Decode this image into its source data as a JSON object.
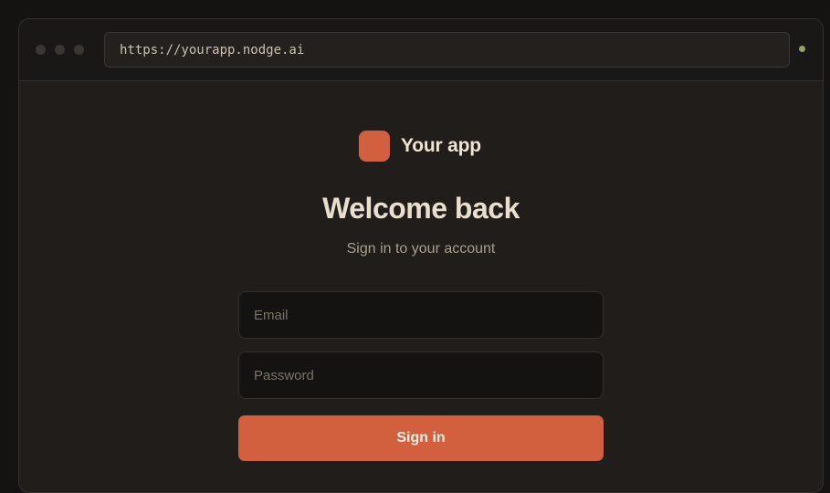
{
  "browser": {
    "url": "https://yourapp.nodge.ai"
  },
  "brand": {
    "name": "Your app",
    "logo_color": "#d2603f"
  },
  "login": {
    "title": "Welcome back",
    "subtitle": "Sign in to your account",
    "email_placeholder": "Email",
    "password_placeholder": "Password",
    "submit_label": "Sign in"
  },
  "colors": {
    "accent": "#d2603f",
    "background": "#201d1a",
    "status": "#8fa36a"
  }
}
